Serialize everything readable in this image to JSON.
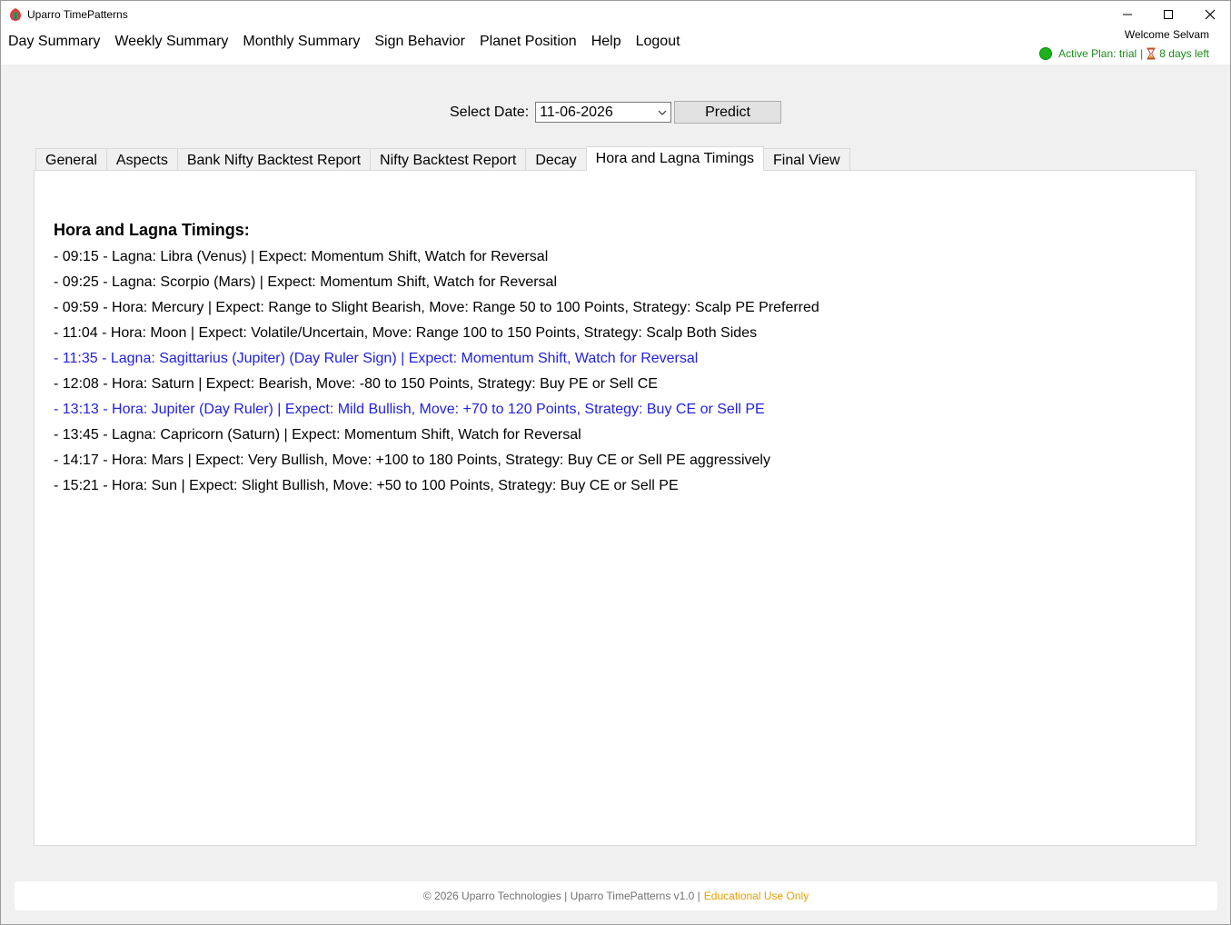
{
  "window": {
    "title": "Uparro TimePatterns"
  },
  "menu": {
    "items": [
      "Day Summary",
      "Weekly Summary",
      "Monthly Summary",
      "Sign Behavior",
      "Planet Position",
      "Help",
      "Logout"
    ]
  },
  "account": {
    "welcome": "Welcome Selvam",
    "plan": "Active Plan: trial",
    "separator": "|",
    "days_left": "8 days left",
    "status_color": "#1ab31a"
  },
  "date_picker": {
    "label": "Select Date:",
    "value": "11-06-2026",
    "predict_label": "Predict"
  },
  "tabs": [
    {
      "label": "General",
      "active": false
    },
    {
      "label": "Aspects",
      "active": false
    },
    {
      "label": "Bank Nifty Backtest Report",
      "active": false
    },
    {
      "label": "Nifty Backtest Report",
      "active": false
    },
    {
      "label": "Decay",
      "active": false
    },
    {
      "label": "Hora and Lagna Timings",
      "active": true
    },
    {
      "label": "Final View",
      "active": false
    }
  ],
  "content": {
    "heading": "Hora and Lagna Timings:",
    "highlight_color": "#2222dd",
    "lines": [
      {
        "text": "- 09:15 - Lagna: Libra (Venus) | Expect: Momentum Shift, Watch for Reversal",
        "highlight": false
      },
      {
        "text": "- 09:25 - Lagna: Scorpio (Mars) | Expect: Momentum Shift, Watch for Reversal",
        "highlight": false
      },
      {
        "text": "- 09:59 - Hora: Mercury | Expect: Range to Slight Bearish, Move: Range 50 to 100 Points, Strategy: Scalp PE Preferred",
        "highlight": false
      },
      {
        "text": "- 11:04 - Hora: Moon | Expect: Volatile/Uncertain, Move: Range 100 to 150 Points, Strategy: Scalp Both Sides",
        "highlight": false
      },
      {
        "text": "- 11:35 - Lagna: Sagittarius (Jupiter) (Day Ruler Sign) | Expect: Momentum Shift, Watch for Reversal",
        "highlight": true
      },
      {
        "text": "- 12:08 - Hora: Saturn | Expect: Bearish, Move: -80 to 150 Points, Strategy: Buy PE or Sell CE",
        "highlight": false
      },
      {
        "text": "- 13:13 - Hora: Jupiter (Day Ruler) | Expect: Mild Bullish, Move: +70 to 120 Points, Strategy: Buy CE or Sell PE",
        "highlight": true
      },
      {
        "text": "- 13:45 - Lagna: Capricorn (Saturn) | Expect: Momentum Shift, Watch for Reversal",
        "highlight": false
      },
      {
        "text": "- 14:17 - Hora: Mars | Expect: Very Bullish, Move: +100 to 180 Points, Strategy: Buy CE or Sell PE aggressively",
        "highlight": false
      },
      {
        "text": "- 15:21 - Hora: Sun | Expect: Slight Bullish, Move: +50 to 100 Points, Strategy: Buy CE or Sell PE",
        "highlight": false
      }
    ]
  },
  "footer": {
    "text": "© 2026 Uparro Technologies | Uparro TimePatterns v1.0 |",
    "edu": "Educational Use Only",
    "edu_color": "#e6a000"
  }
}
